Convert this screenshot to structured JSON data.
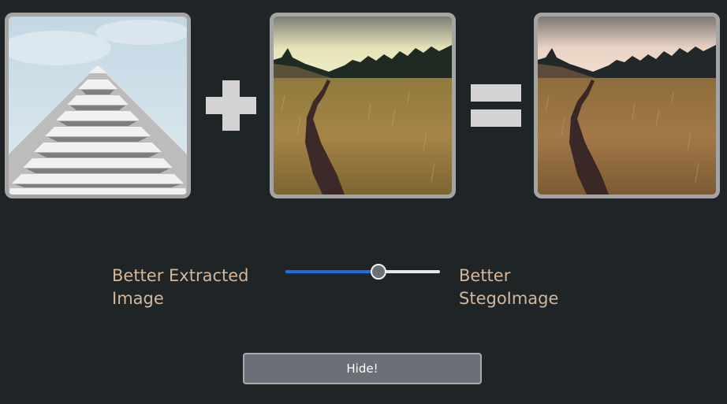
{
  "images": {
    "cover": {
      "name": "building-photo"
    },
    "secret": {
      "name": "meadow-path-photo"
    },
    "stego": {
      "name": "meadow-path-stego-photo"
    }
  },
  "operators": {
    "plus": "plus-icon",
    "equals": "equals-icon"
  },
  "slider": {
    "left_label": "Better Extracted Image",
    "right_label": "Better StegoImage",
    "value_fraction": 0.6
  },
  "hide_button": {
    "label": "Hide!"
  },
  "colors": {
    "background": "#1f2527",
    "frame": "#a4a4a4",
    "label": "#d5b69a",
    "slider_fill": "#1a6fe3",
    "button": "#6b6f77"
  }
}
